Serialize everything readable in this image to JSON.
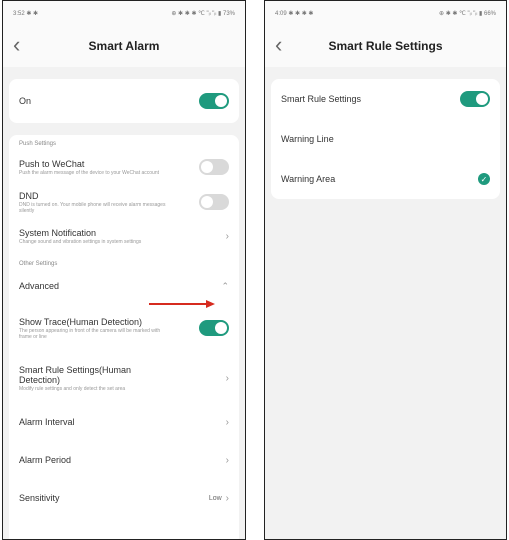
{
  "left_screen": {
    "status": {
      "time": "3:52 ✱ ✱",
      "icons": "⊕ ✱ ✱ ✱ ℃ \"ᵢₗ \"ᵢₗ ▮ 73%"
    },
    "title": "Smart Alarm",
    "back_icon": "chevron-left-icon",
    "on_label": "On",
    "on_state": true,
    "push_settings_header": "Push Settings",
    "push_wechat": {
      "label": "Push to WeChat",
      "desc": "Push the alarm message of the device to your WeChat account",
      "state": false
    },
    "dnd": {
      "label": "DND",
      "desc": "DND is turned on. Your mobile phone will receive alarm messages silently",
      "state": false
    },
    "system_notification": {
      "label": "System Notification",
      "desc": "Change sound and vibration settings in system settings"
    },
    "other_settings_header": "Other Settings",
    "advanced_label": "Advanced",
    "show_trace": {
      "label": "Show Trace(Human Detection)",
      "desc": "The person appearing in front of the camera will be marked with frame or line",
      "state": true
    },
    "smart_rule": {
      "label": "Smart Rule Settings(Human Detection)",
      "desc": "Modify rule settings and only detect the set area"
    },
    "alarm_interval": "Alarm Interval",
    "alarm_period": "Alarm Period",
    "sensitivity_label": "Sensitivity",
    "sensitivity_value": "Low"
  },
  "right_screen": {
    "status": {
      "time": "4:09 ✱ ✱ ✱ ✱",
      "icons": "⊕ ✱ ✱ ℃ \"ᵢₗ \"ᵢₗ ▮ 66%"
    },
    "title": "Smart Rule Settings",
    "back_icon": "chevron-left-icon",
    "smart_rule_label": "Smart Rule Settings",
    "smart_rule_state": true,
    "warning_line": "Warning Line",
    "warning_area": "Warning Area",
    "warning_area_selected": true
  },
  "colors": {
    "accent": "#1f9a7e",
    "annotation_arrow": "#d62b1f"
  }
}
